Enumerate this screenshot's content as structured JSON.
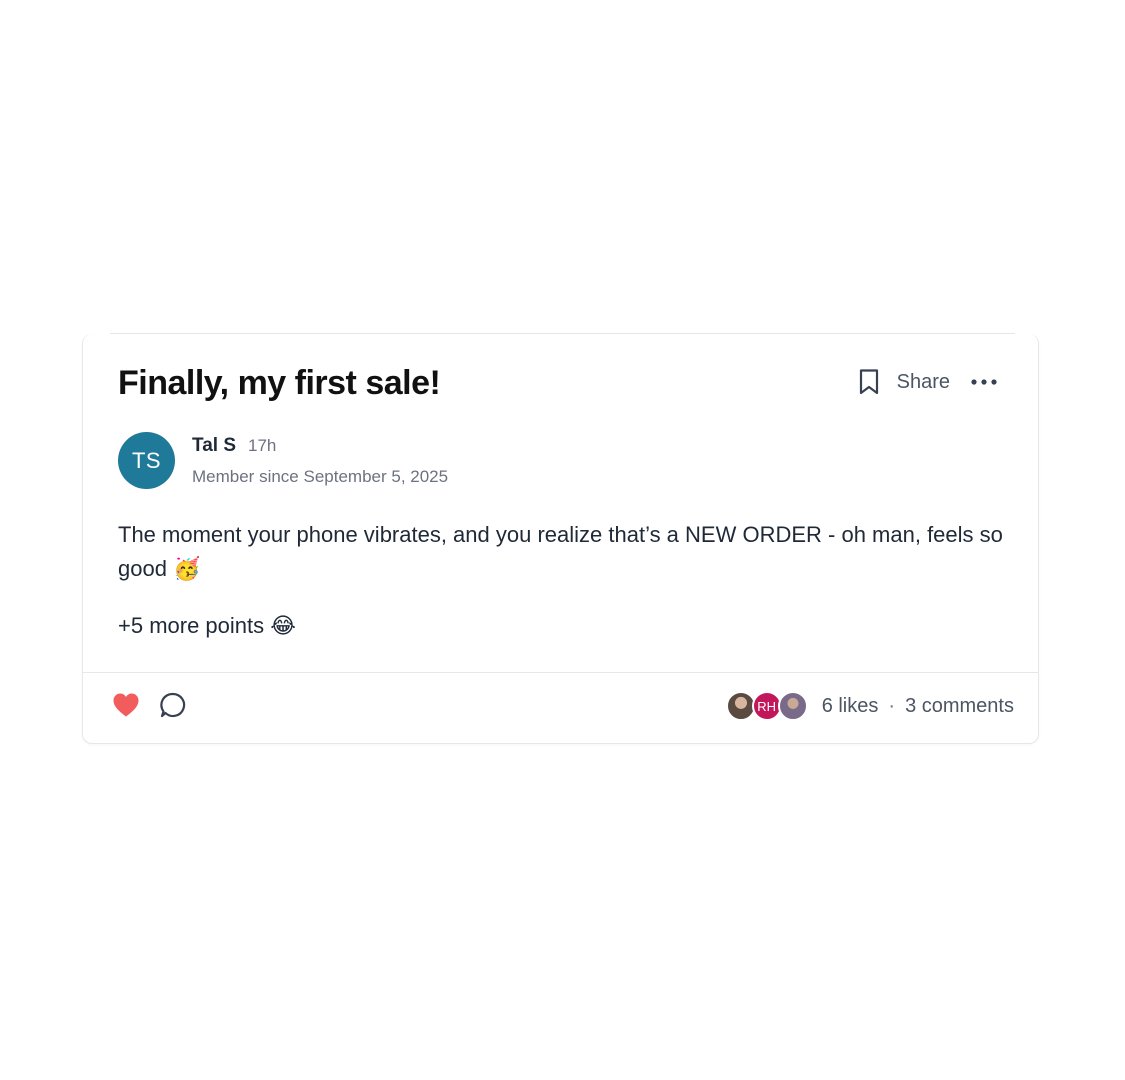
{
  "post": {
    "title": "Finally, my first sale!",
    "actions": {
      "bookmark_icon": "bookmark-icon",
      "share_label": "Share",
      "more_icon": "more-horizontal-icon"
    },
    "author": {
      "initials": "TS",
      "avatar_color": "#1f7a99",
      "name": "Tal S",
      "time": "17h",
      "member_since": "Member since September 5, 2025"
    },
    "body": [
      "The moment your phone vibrates, and you realize that’s a NEW ORDER - oh man, feels so good 🥳",
      "+5 more points 😂"
    ],
    "footer": {
      "like_icon": "heart-icon",
      "like_color": "#f25c5c",
      "comment_icon": "comment-icon",
      "likers": [
        {
          "type": "photo"
        },
        {
          "type": "initials",
          "initials": "RH",
          "color": "#c2185b"
        },
        {
          "type": "photo"
        }
      ],
      "likes_label": "6 likes",
      "separator": "·",
      "comments_label": "3 comments"
    }
  }
}
